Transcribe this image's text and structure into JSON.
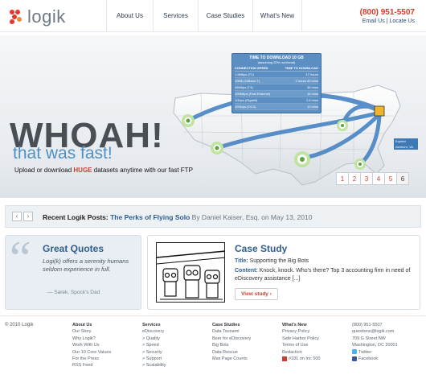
{
  "header": {
    "logo_text": "logik",
    "nav": [
      "About Us",
      "Services",
      "Case Studies",
      "What's New"
    ],
    "phone": "(800) 951-5507",
    "email_link": "Email Us",
    "locate_link": "Locate Us",
    "link_sep": "|"
  },
  "hero": {
    "headline": "WHOAH!",
    "subheadline": "that was fast!",
    "tagline_pre": "Upload or download ",
    "tagline_em": "HUGE",
    "tagline_post": " datasets anytime with our fast FTP",
    "download_box": {
      "title": "TIME TO DOWNLOAD 10 GB",
      "subtitle": "(assuming 20% overhead)",
      "col1": "CONNECTION SPEED",
      "col2": "TIME TO DOWNLOAD",
      "rows": [
        [
          "1.5Mbps (T1)",
          "17 hours"
        ],
        [
          "10Mb (10Base-T)",
          "2 hours 40 mins"
        ],
        [
          "45Mbps (T3)",
          "36 mins"
        ],
        [
          "100Mbps (Fast Ethernet)",
          "16 mins"
        ],
        [
          "1Gbps (Gigabit)",
          "1.6 mins"
        ],
        [
          "10Gbps (OC3)",
          "10 mins"
        ]
      ]
    },
    "equinix_label": "Equinix Ashburn, VA",
    "pager": [
      "1",
      "2",
      "3",
      "4",
      "5",
      "6"
    ],
    "pager_active": "6",
    "colors": {
      "accent_red": "#d33b2c",
      "brand_blue": "#4f91c4",
      "box_blue": "#5b8fc4"
    }
  },
  "news": {
    "prev_icon": "‹",
    "next_icon": "›",
    "label": "Recent Logik Posts:",
    "post_title": "The Perks of Flying Solo",
    "byline": "By Daniel Kaiser, Esq. on May 13, 2010"
  },
  "quotes": {
    "quote_mark": "“",
    "heading": "Great Quotes",
    "text": "Logi(k) offers a serenity humans seldom experience in full.",
    "author": "— Sarek, Spock's Dad"
  },
  "case_study": {
    "heading": "Case Study",
    "title_label": "Title:",
    "title_value": "Supporting the Big Bots",
    "content_label": "Content:",
    "content_value": "Knock, knock. Who's there? Top 3 accounting firm in need of eDiscovery assistance [...]",
    "button": "View study",
    "button_arrow": "›"
  },
  "footer": {
    "copyright": "© 2010 Logik",
    "about": {
      "heading": "About Us",
      "items": [
        "Our Story",
        "Why Logik?",
        "Work With Us",
        "Our 10 Core Values",
        "For the Press",
        "RSS Feed"
      ]
    },
    "services": {
      "heading": "Services",
      "items": [
        "eDiscovery",
        "> Quality",
        "> Speed",
        "> Security",
        "> Support",
        "> Scalability"
      ]
    },
    "case_studies": {
      "heading": "Case Studies",
      "items": [
        "Data Tsunami",
        "Beer for eDiscovery",
        "Big Bots",
        "Data Rescue",
        "Max Page Counts"
      ]
    },
    "whats_new": {
      "heading": "What's New",
      "items": [
        "Privacy Policy",
        "Safe Harbor Policy",
        "Terms of Use",
        "Redaction"
      ],
      "inc": "#181 on Inc 500"
    },
    "contact": {
      "phone": "(800) 951-5507",
      "email": "questions@logik.com",
      "street": "709 G Street NW",
      "city": "Washington, DC 20001",
      "twitter": "Twitter",
      "facebook": "Facebook"
    }
  }
}
